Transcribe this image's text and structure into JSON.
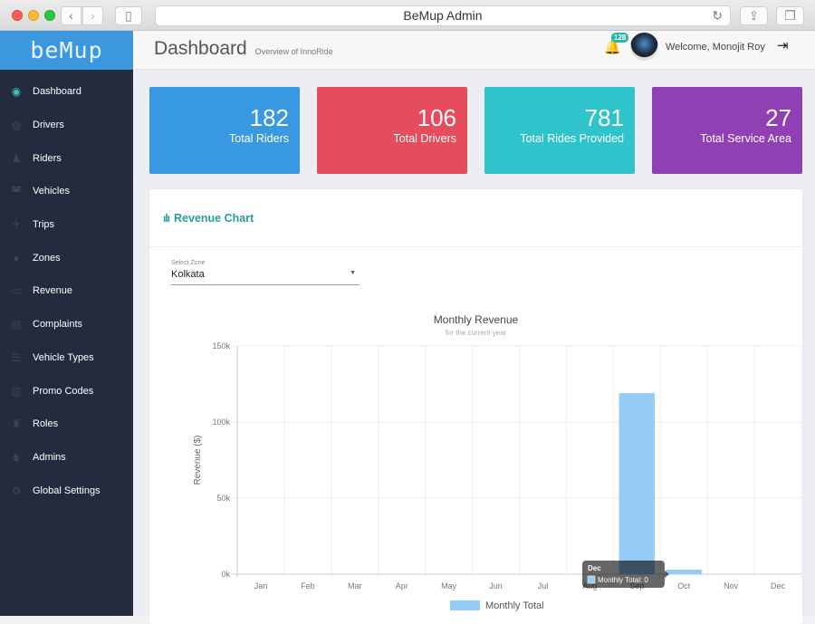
{
  "browser": {
    "title": "BeMup Admin",
    "back_icon": "‹",
    "forward_icon": "›",
    "sidebar_icon": "▯",
    "reload_icon": "↻",
    "share_icon": "⇪",
    "tabs_icon": "❐"
  },
  "brand": {
    "logo_text": "beMup",
    "accent": "#3b97de"
  },
  "header": {
    "title": "Dashboard",
    "subtitle": "Overview of InnoRide",
    "notification_count": "128",
    "welcome": "Welcome, Monojit Roy",
    "bell_icon": "🔔",
    "logout_icon": "⇥"
  },
  "sidebar": {
    "items": [
      {
        "label": "Dashboard",
        "icon": "◉",
        "active": true
      },
      {
        "label": "Drivers",
        "icon": "◍"
      },
      {
        "label": "Riders",
        "icon": "♟"
      },
      {
        "label": "Vehicles",
        "icon": "◚"
      },
      {
        "label": "Trips",
        "icon": "✈"
      },
      {
        "label": "Zones",
        "icon": "●"
      },
      {
        "label": "Revenue",
        "icon": "▭"
      },
      {
        "label": "Complaints",
        "icon": "▤"
      },
      {
        "label": "Vehicle Types",
        "icon": "☰"
      },
      {
        "label": "Promo Codes",
        "icon": "▥"
      },
      {
        "label": "Roles",
        "icon": "♜"
      },
      {
        "label": "Admins",
        "icon": "♞"
      },
      {
        "label": "Global Settings",
        "icon": "⚙"
      }
    ]
  },
  "stats": [
    {
      "value": "182",
      "label": "Total Riders",
      "color": "#3898e0"
    },
    {
      "value": "106",
      "label": "Total Drivers",
      "color": "#e64c5b"
    },
    {
      "value": "781",
      "label": "Total Rides Provided",
      "color": "#2fc3cb"
    },
    {
      "value": "27",
      "label": "Total Service Area",
      "color": "#9040b3"
    }
  ],
  "revenue_panel": {
    "heading": "Revenue Chart",
    "heading_icon": "ılı",
    "select_label": "Select Zone",
    "select_value": "Kolkata",
    "select_arrow": "▼"
  },
  "chart_data": {
    "type": "bar",
    "title": "Monthly Revenue",
    "subtitle": "for the current year",
    "xlabel": "",
    "ylabel": "Revenue ($)",
    "categories": [
      "Jan",
      "Feb",
      "Mar",
      "Apr",
      "May",
      "Jun",
      "Jul",
      "Aug",
      "Sep",
      "Oct",
      "Nov",
      "Dec"
    ],
    "series": [
      {
        "name": "Monthly Total",
        "color": "#95cbf7",
        "values": [
          0,
          0,
          0,
          0,
          0,
          0,
          0,
          0,
          119000,
          3000,
          0,
          0
        ]
      }
    ],
    "ylim": [
      0,
      150000
    ],
    "yticks": [
      0,
      50000,
      100000,
      150000
    ],
    "ytick_labels": [
      "0k",
      "50k",
      "100k",
      "150k"
    ],
    "grid": true,
    "legend": "bottom",
    "tooltip": {
      "title": "Dec",
      "text": "Monthly Total: 0"
    }
  }
}
